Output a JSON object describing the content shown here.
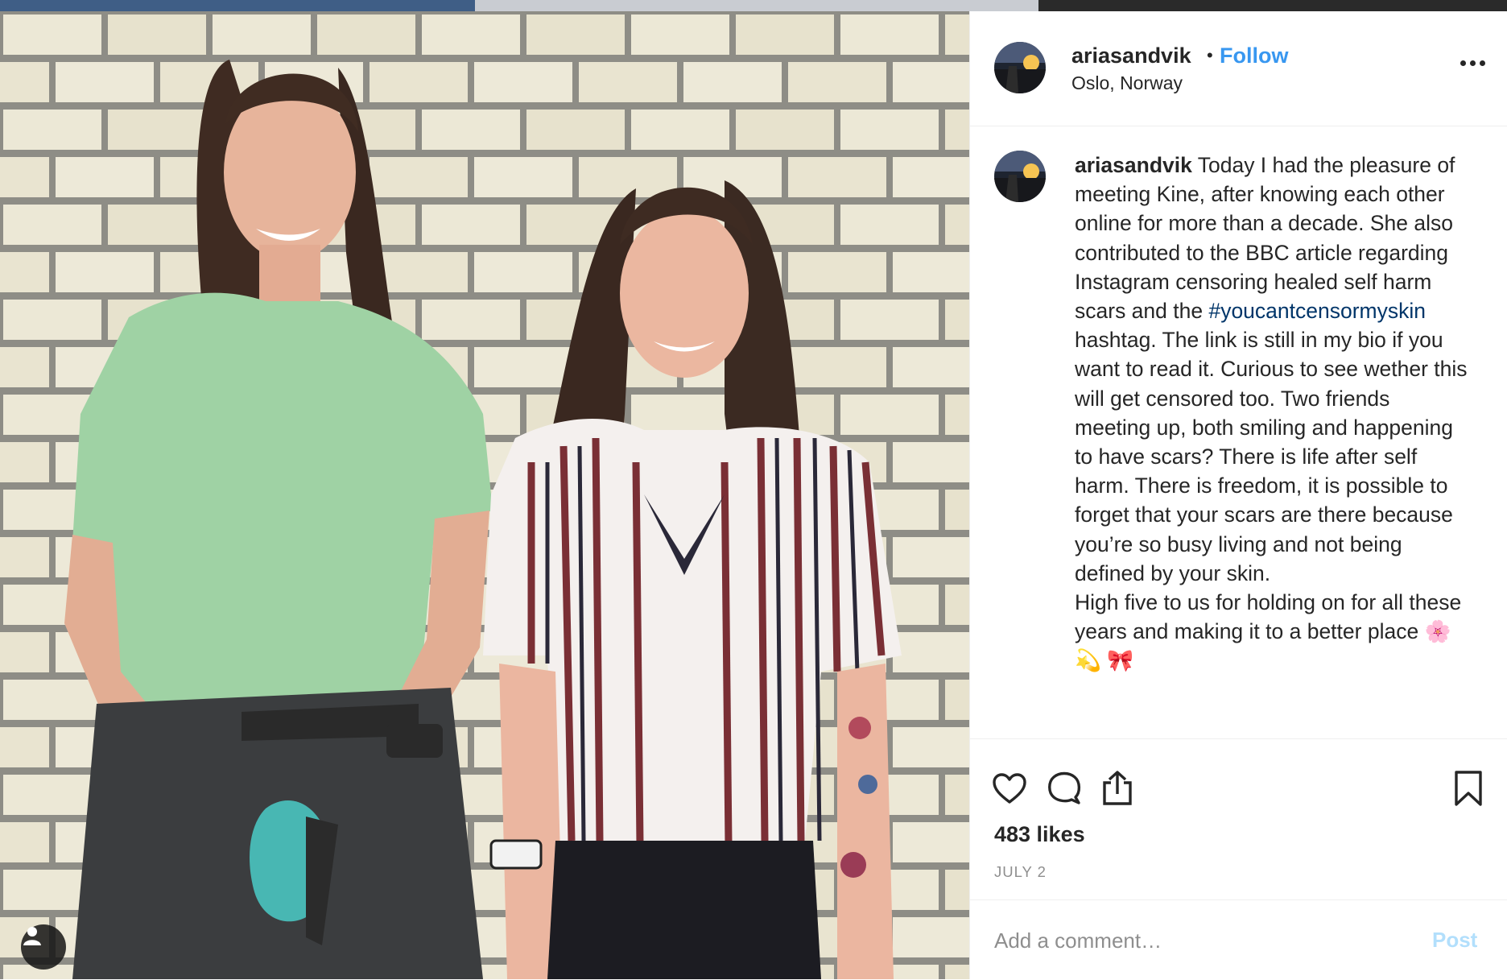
{
  "colors": {
    "link_blue": "#3897f0",
    "hashtag_blue": "#003569",
    "text": "#262626",
    "muted": "#8e8e8e",
    "post_disabled": "#b2dffc"
  },
  "photo": {
    "user_tag_icon": "person-icon"
  },
  "header": {
    "username": "ariasandvik",
    "separator": "•",
    "follow_label": "Follow",
    "location": "Oslo, Norway",
    "more_icon": "more-options-icon"
  },
  "caption": {
    "username": "ariasandvik",
    "text_before_tag": " Today I had the pleasure of meeting Kine, after knowing each other online for more than a decade. She also contributed to the BBC article regarding Instagram censoring healed self harm scars and the ",
    "hashtag": "#youcantcensormyskin",
    "text_after_tag": " hashtag. The link is still in my bio if you want to read it. Curious to see wether this will get censored too. Two friends meeting up, both smiling and happening to have scars? There is life after self harm. There is freedom, it is possible to forget that your scars are there because you’re so busy living and not being defined by your skin.\nHigh five to us for holding on for all these years and making it to a better place 🌸 💫 🎀"
  },
  "actions": {
    "like_icon": "heart-icon",
    "comment_icon": "comment-icon",
    "share_icon": "share-icon",
    "save_icon": "bookmark-icon",
    "likes": "483 likes",
    "date": "JULY 2"
  },
  "comment": {
    "placeholder": "Add a comment…",
    "post_label": "Post"
  }
}
